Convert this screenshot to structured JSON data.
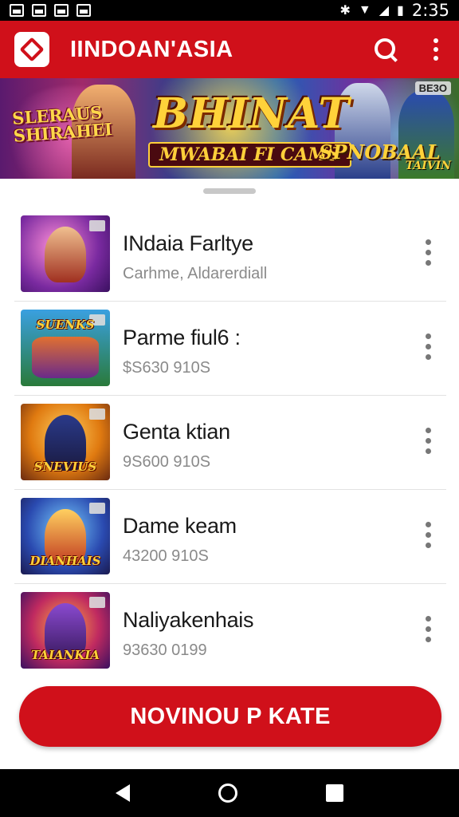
{
  "status_bar": {
    "time": "2:35"
  },
  "app_bar": {
    "title": "IINDOAN'ASIA"
  },
  "banner": {
    "left_text": "SLERAUS SHIRAHEI",
    "title": "BHINAT",
    "subtitle": "MWABAI FI CAMS",
    "right_text": "SPNOBAAL",
    "corner_label": "BE3O",
    "small_text": "TAIVIN"
  },
  "games": [
    {
      "title": "INdaia Farltye",
      "subtitle": "Carhme, Aldarerdiall",
      "thumb_text": ""
    },
    {
      "title": "Parme fiul6 :",
      "subtitle": "$S630 910S",
      "thumb_text": "SUENKS"
    },
    {
      "title": "Genta ktian",
      "subtitle": "9S600 910S",
      "thumb_text": "SNEVIUS"
    },
    {
      "title": "Dame keam",
      "subtitle": "43200 910S",
      "thumb_text": "DIANHAIS"
    },
    {
      "title": "Naliyakenhais",
      "subtitle": "93630 0199",
      "thumb_text": "TAIANKIA"
    }
  ],
  "cta": {
    "label": "NOVINOU P KATE"
  },
  "colors": {
    "primary": "#d0101a",
    "text": "#1a1a1a",
    "muted": "#8a8a8a"
  }
}
